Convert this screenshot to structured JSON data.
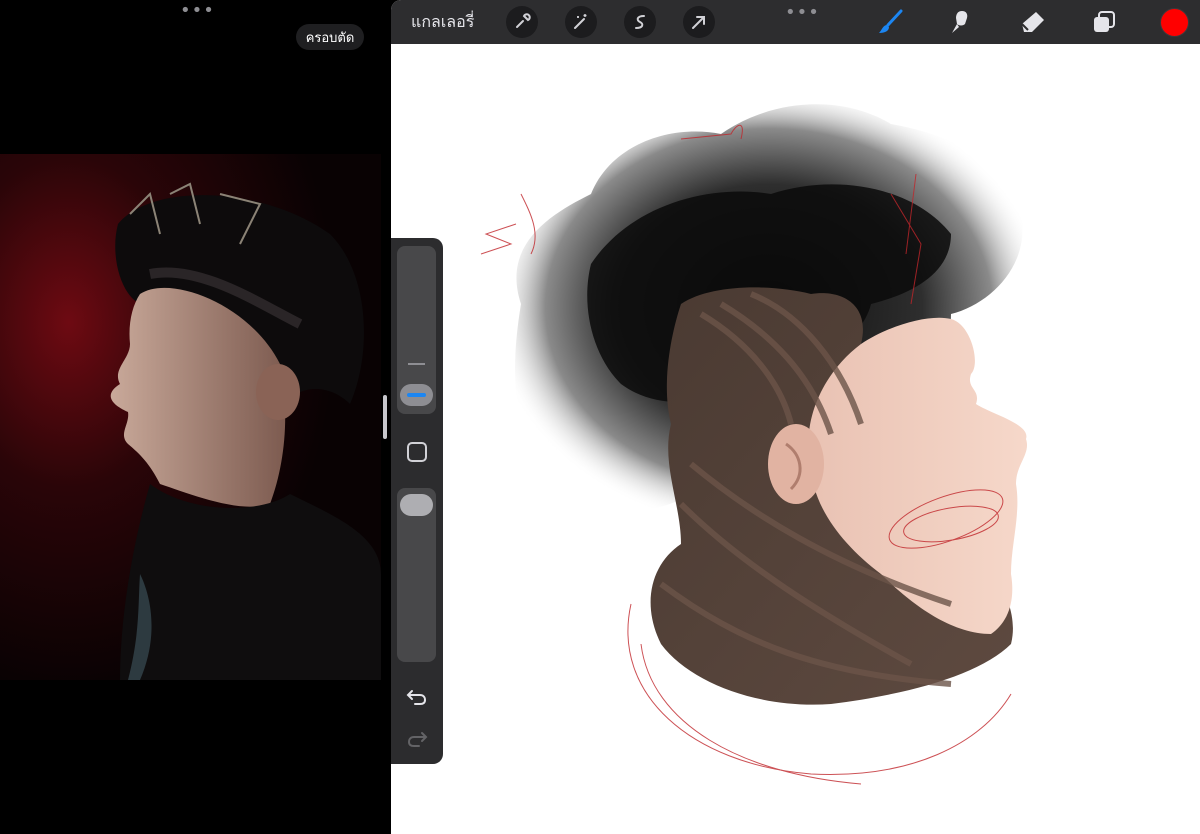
{
  "left_pane": {
    "more_icon": "ellipsis-icon",
    "crop_label": "ครอบตัด"
  },
  "procreate": {
    "gallery_label": "แกลเลอรี่",
    "actions": [
      "wrench-icon",
      "magic-wand-icon",
      "selection-icon",
      "transform-arrow-icon"
    ],
    "tools": [
      "brush-icon",
      "smudge-icon",
      "eraser-icon",
      "layers-icon"
    ],
    "active_tool": "brush",
    "current_color": "#ff0000",
    "sidebar": {
      "brush_size_level": 0.9,
      "opacity_level": 0.05
    }
  }
}
